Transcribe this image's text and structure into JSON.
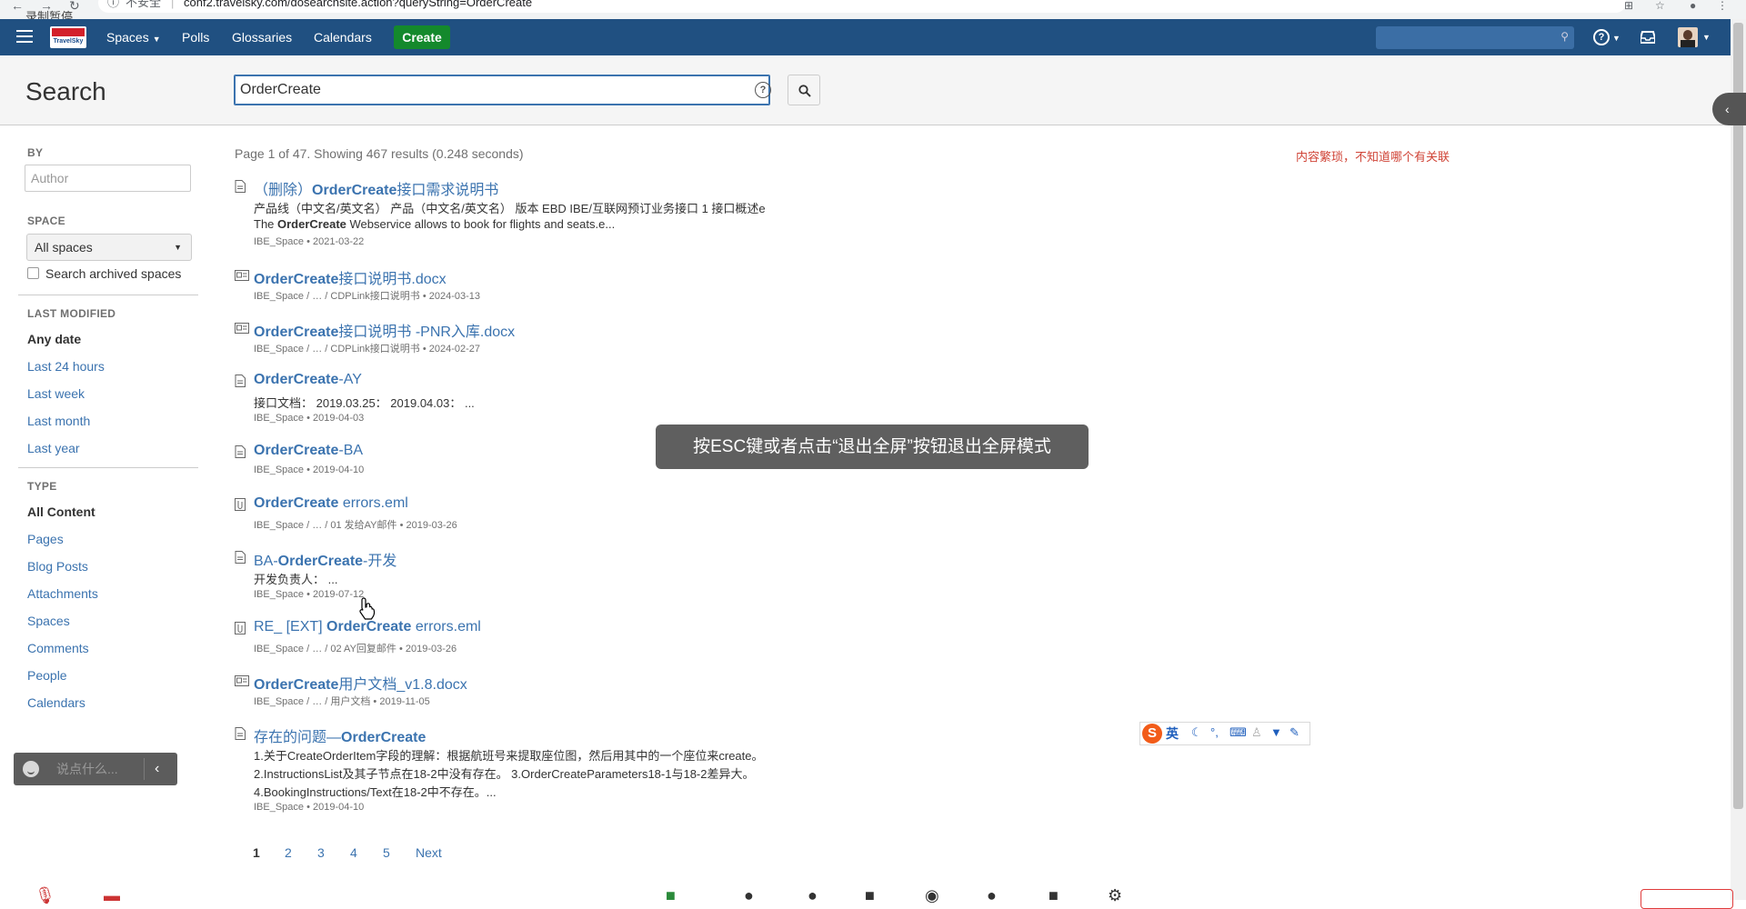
{
  "browser": {
    "overlay_label": "录制暂停",
    "nav_back": "←",
    "nav_forward": "→",
    "reload": "↻",
    "security_label": "不安全",
    "url": "conf2.travelsky.com/dosearchsite.action?queryString=OrderCreate",
    "info_icon": "info-icon"
  },
  "header": {
    "logo_text": "TravelSky",
    "nav": {
      "spaces": "Spaces",
      "polls": "Polls",
      "glossaries": "Glossaries",
      "calendars": "Calendars"
    },
    "create_label": "Create",
    "search_placeholder": "",
    "help_icon": "?",
    "colors": {
      "header_bg": "#205081",
      "create_bg": "#14892c"
    }
  },
  "search": {
    "title": "Search",
    "query": "OrderCreate",
    "help_glyph": "?"
  },
  "sidebar": {
    "by_heading": "BY",
    "author_placeholder": "Author",
    "space_heading": "SPACE",
    "space_value": "All spaces",
    "archived_label": "Search archived spaces",
    "last_modified_heading": "LAST MODIFIED",
    "dates": [
      "Any date",
      "Last 24 hours",
      "Last week",
      "Last month",
      "Last year"
    ],
    "type_heading": "TYPE",
    "types": [
      "All Content",
      "Pages",
      "Blog Posts",
      "Attachments",
      "Spaces",
      "Comments",
      "People",
      "Calendars"
    ]
  },
  "results": {
    "summary": "Page 1 of 47. Showing 467 results (0.248 seconds)",
    "note": "内容繁琐，不知道哪个有关联",
    "items": [
      {
        "icon": "page-icon",
        "title_pre": "（删除）",
        "title_bold": "OrderCreate",
        "title_post": "接口需求说明书",
        "excerpt1": "产品线（中文名/英文名） 产品（中文名/英文名） 版本 EBD IBE/互联网预订业务接口 1 接口概述e",
        "excerpt2_pre": "The ",
        "excerpt2_bold": "OrderCreate",
        "excerpt2_post": " Webservice allows to book for flights and seats.e...",
        "meta": "IBE_Space • 2021-03-22"
      },
      {
        "icon": "document-icon",
        "title_bold": "OrderCreate",
        "title_post": "接口说明书.docx",
        "meta": "IBE_Space / … / CDPLink接口说明书 • 2024-03-13"
      },
      {
        "icon": "document-icon",
        "title_bold": "OrderCreate",
        "title_post": "接口说明书 -PNR入库.docx",
        "meta": "IBE_Space / … / CDPLink接口说明书 • 2024-02-27"
      },
      {
        "icon": "page-icon",
        "title_bold": "OrderCreate",
        "title_post": "-AY",
        "excerpt1": "接口文档： 2019.03.25： 2019.04.03： ...",
        "meta": "IBE_Space • 2019-04-03"
      },
      {
        "icon": "page-icon",
        "title_bold": "OrderCreate",
        "title_post": "-BA",
        "meta": "IBE_Space • 2019-04-10"
      },
      {
        "icon": "attachment-icon",
        "title_bold": "OrderCreate",
        "title_post": " errors.eml",
        "meta": "IBE_Space / … / 01 发给AY邮件 • 2019-03-26"
      },
      {
        "icon": "page-icon",
        "title_pre": "BA-",
        "title_bold": "OrderCreate",
        "title_post": "-开发",
        "excerpt1": "开发负责人： ...",
        "meta": "IBE_Space • 2019-07-12"
      },
      {
        "icon": "attachment-icon",
        "title_pre": "RE_ [EXT] ",
        "title_bold": "OrderCreate",
        "title_post": " errors.eml",
        "meta": "IBE_Space / … / 02 AY回复邮件 • 2019-03-26"
      },
      {
        "icon": "document-icon",
        "title_bold": "OrderCreate",
        "title_post": "用户文档_v1.8.docx",
        "meta": "IBE_Space / … / 用户文档 • 2019-11-05"
      },
      {
        "icon": "page-icon",
        "title_pre": "存在的问题—",
        "title_bold": "OrderCreate",
        "excerpt1": "1.关于CreateOrderItem字段的理解：根据航班号来提取座位图，然后用其中的一个座位来create。",
        "excerpt2": "2.InstructionsList及其子节点在18-2中没有存在。 3.OrderCreateParameters18-1与18-2差异大。",
        "excerpt3": "4.BookingInstructions/Text在18-2中不存在。...",
        "meta": "IBE_Space • 2019-04-10"
      }
    ]
  },
  "pagination": {
    "pages": [
      "1",
      "2",
      "3",
      "4",
      "5"
    ],
    "next": "Next",
    "current": "1"
  },
  "toast": {
    "text": "按ESC键或者点击“退出全屏”按钮退出全屏模式"
  },
  "chat": {
    "placeholder": "说点什么...",
    "chevron": "‹"
  },
  "ime": {
    "logo": "S",
    "lang": "英"
  },
  "collapse_tab": {
    "glyph": "‹"
  }
}
